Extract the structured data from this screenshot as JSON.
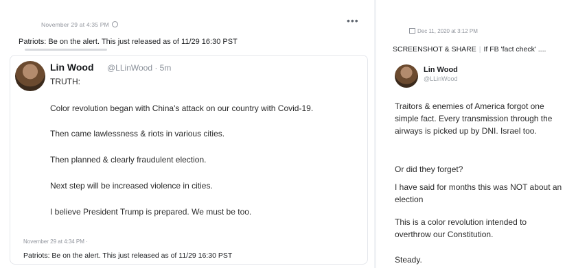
{
  "left_post": {
    "timestamp": "November 29 at 4:35 PM",
    "more_label": "•••",
    "caption": "Patriots: Be on the alert. This just released as of 11/29  16:30 PST",
    "tweet": {
      "author": "Lin Wood",
      "handle": "@LLinWood · 5m",
      "lines": [
        "TRUTH:",
        "Color revolution began with China's attack on our country with Covid-19.",
        "Then came lawlessness & riots in various cities.",
        "Then planned & clearly fraudulent election.",
        "Next step will be increased violence in cities.",
        "I believe President Trump is prepared. We must be too."
      ]
    },
    "shared_timestamp": "November 29 at 4:34 PM ·",
    "shared_caption": "Patriots: Be on the alert. This just released as of 11/29  16:30 PST"
  },
  "right_post": {
    "timestamp": "Dec 11, 2020 at 3:12 PM",
    "caption_part1": "SCREENSHOT & SHARE",
    "caption_sep": "|",
    "caption_part2": "If FB 'fact check' ....",
    "author": "Lin Wood",
    "handle": "@LLinWood",
    "lines": [
      "Traitors & enemies of America forgot one simple fact. Every transmission through the airways is picked up by DNI. Israel too.",
      "Or did they forget?",
      "I have said for months this was NOT about an election",
      "This is a color revolution intended to overthrow our Constitution.",
      "Steady."
    ]
  }
}
